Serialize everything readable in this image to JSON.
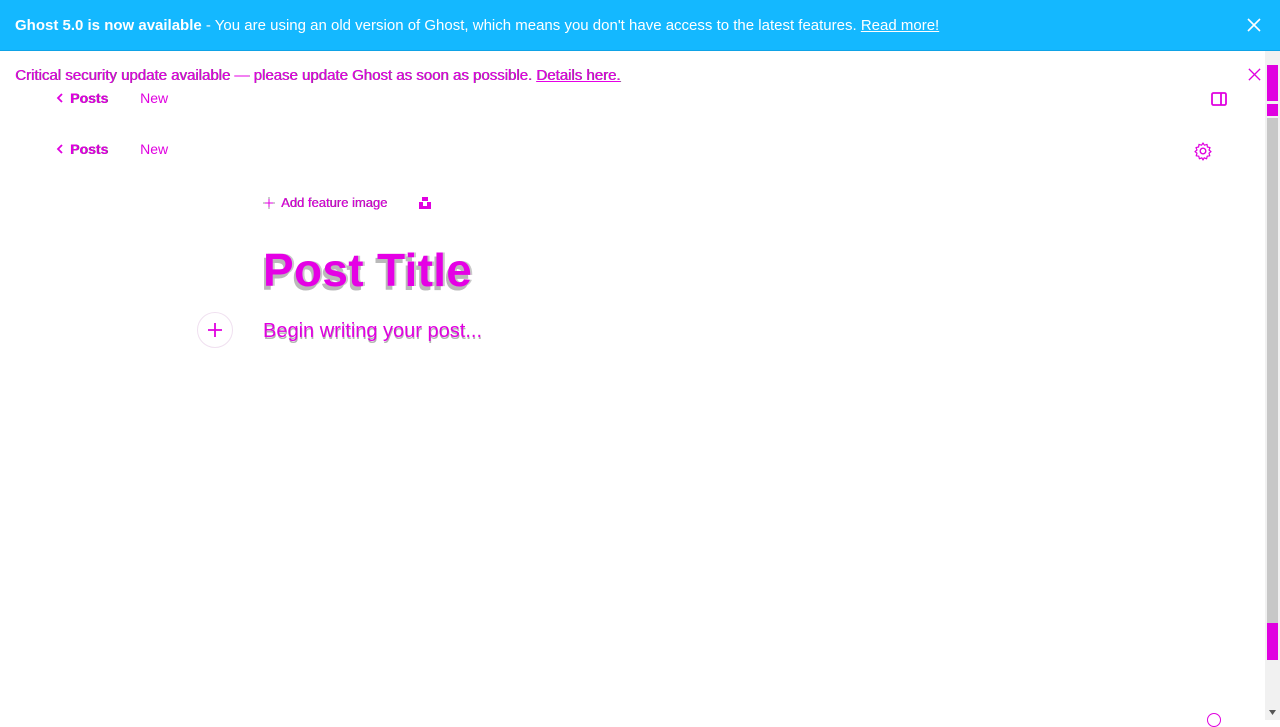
{
  "banner": {
    "strong": "Ghost 5.0 is now available",
    "message": " - You are using an old version of Ghost, which means you don't have access to the latest features. ",
    "link": "Read more!",
    "background": "#14b8ff"
  },
  "security": {
    "message": "Critical security update available — please update Ghost as soon as possible. ",
    "link": "Details here."
  },
  "breadcrumb": {
    "back_label": "Posts",
    "status": "New"
  },
  "editor": {
    "feature_image_label": "Add feature image",
    "title_placeholder": "Post Title",
    "body_placeholder": "Begin writing your post..."
  },
  "colors": {
    "accent": "#e000e0",
    "banner": "#14b8ff"
  },
  "icons": {
    "close": "close-icon",
    "back": "chevron-left-icon",
    "sidebar": "sidebar-toggle-icon",
    "settings": "gear-icon",
    "plus": "plus-icon",
    "unsplash": "unsplash-icon"
  }
}
